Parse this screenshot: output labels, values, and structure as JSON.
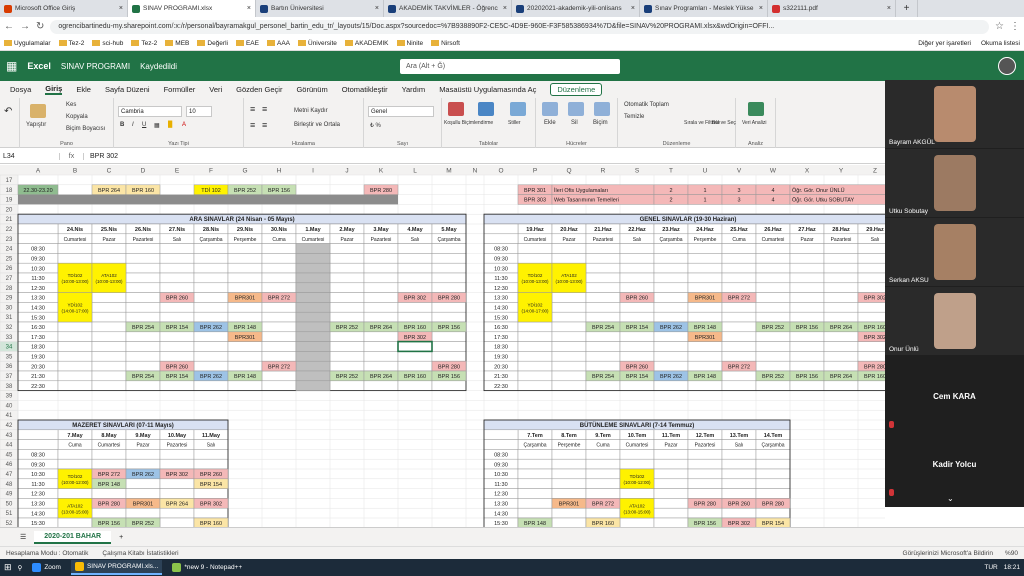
{
  "browser": {
    "tabs": [
      {
        "label": "Microsoft Office Giriş",
        "color": "#d83b01"
      },
      {
        "label": "SINAV PROGRAMI.xlsx",
        "color": "#217346",
        "active": true
      },
      {
        "label": "Bartın Üniversitesi",
        "color": "#1a3f7a"
      },
      {
        "label": "AKADEMİK TAKVİMLER - Öğrenc",
        "color": "#1a3f7a"
      },
      {
        "label": "20202021-akademik-yili-onlisans",
        "color": "#1a3f7a"
      },
      {
        "label": "Sınav Programları - Meslek Yükse",
        "color": "#1a3f7a"
      },
      {
        "label": "s322111.pdf",
        "color": "#d32f2f"
      }
    ],
    "url": "ogrencibartinedu-my.sharepoint.com/:x:/r/personal/bayramakgul_personel_bartin_edu_tr/_layouts/15/Doc.aspx?sourcedoc=%7B938890F2-CE5C-4D9E-960E-F3F585386934%7D&file=SINAV%20PROGRAMI.xlsx&wdOrigin=OFFI...",
    "bookmarks": [
      "Uygulamalar",
      "Tez-2",
      "sci-hub",
      "Tez-2",
      "MEB",
      "Değerli",
      "EAE",
      "AAA",
      "Üniversite",
      "AKADEMIK",
      "Ninite",
      "Nirsoft"
    ],
    "bookmarks_right": [
      "Diğer yer işaretleri",
      "Okuma listesi"
    ]
  },
  "excel": {
    "app": "Excel",
    "doc_title": "SINAV PROGRAMI",
    "saved": "Kaydedildi",
    "search_placeholder": "Ara (Alt + Ğ)",
    "menu": [
      "Dosya",
      "Giriş",
      "Ekle",
      "Sayfa Düzeni",
      "Formüller",
      "Veri",
      "Gözden Geçir",
      "Görünüm",
      "Otomatikleştir",
      "Yardım",
      "Masaüstü Uygulamasında Aç"
    ],
    "menu_selected": "Giriş",
    "edit_mode": "Düzenleme",
    "ribbon": {
      "undo": "Geri Al",
      "paste": "Yapıştır",
      "cut": "Kes",
      "copy": "Kopyala",
      "format_painter": "Biçim Boyacısı",
      "clipboard": "Pano",
      "font": "Cambria",
      "font_size": "10",
      "font_group": "Yazı Tipi",
      "wrap": "Metni Kaydır",
      "merge": "Birleştir ve Ortala",
      "align_group": "Hizalama",
      "number_format": "Genel",
      "number_group": "Sayı",
      "cond_format": "Koşullu Biçimlendirme",
      "table_format": "Tablo Olarak Biçimlendir",
      "styles": "Stiller",
      "tables_group": "Tablolar",
      "insert": "Ekle",
      "delete": "Sil",
      "format": "Biçim",
      "cells_group": "Hücreler",
      "autosum": "Otomatik Toplam",
      "clear": "Temizle",
      "sort": "Sırala ve Filtrele",
      "find": "Bul ve Seç",
      "edit_group": "Düzenleme",
      "analyze": "Veri Analizi",
      "analysis_group": "Analiz"
    },
    "namebox": "L34",
    "formula": "BPR 302",
    "columns": [
      "A",
      "B",
      "C",
      "D",
      "E",
      "F",
      "G",
      "H",
      "I",
      "J",
      "K",
      "L",
      "M",
      "N",
      "O",
      "P",
      "Q",
      "R",
      "S",
      "T",
      "U",
      "V",
      "W",
      "X",
      "Y",
      "Z"
    ],
    "sheet_tab": "2020-201 BAHAR",
    "status_left": [
      "Hesaplama Modu : Otomatik",
      "Çalışma Kitabı İstatistikleri"
    ],
    "status_right": [
      "Görüşlerinizi Microsoft'a Bildirin",
      "%90"
    ]
  },
  "sheet": {
    "top_rows": {
      "r18_time": "22.30-23.20",
      "left": [
        "BPR 264",
        "BPR 160",
        "TDİ 102",
        "BPR 252",
        "BPR 156",
        "BPR 280"
      ],
      "right_rows": [
        {
          "code": "BPR 301",
          "name": "İleri Ofis Uygulamaları",
          "a": "2",
          "b": "1",
          "c": "3",
          "d": "4",
          "teacher": "Öğr. Gör. Onur ÜNLÜ"
        },
        {
          "code": "BPR 303",
          "name": "Web Tasarımının Temelleri",
          "a": "2",
          "b": "1",
          "c": "3",
          "d": "4",
          "teacher": "Öğr. Gör. Utku SOBUTAY"
        }
      ]
    },
    "ara": {
      "title": "ARA SINAVLAR (24 Nisan - 05 Mayıs)",
      "dates": [
        "24.Nis",
        "25.Nis",
        "26.Nis",
        "27.Nis",
        "28.Nis",
        "29.Nis",
        "30.Nis",
        "1.May",
        "2.May",
        "3.May",
        "4.May",
        "5.May"
      ],
      "days": [
        "Cumartesi",
        "Pazar",
        "Pazartesi",
        "Salı",
        "Çarşamba",
        "Perşembe",
        "Cuma",
        "Cumartesi",
        "Pazar",
        "Pazartesi",
        "Salı",
        "Çarşamba"
      ]
    },
    "genel": {
      "title": "GENEL SINAVLAR (19-30 Haziran)",
      "dates": [
        "19.Haz",
        "20.Haz",
        "21.Haz",
        "22.Haz",
        "23.Haz",
        "24.Haz",
        "25.Haz",
        "26.Haz",
        "27.Haz",
        "28.Haz",
        "29.Haz"
      ],
      "days": [
        "Cumartesi",
        "Pazar",
        "Pazartesi",
        "Salı",
        "Çarşamba",
        "Perşembe",
        "Cuma",
        "Cumartesi",
        "Pazar",
        "Pazartesi",
        "Salı"
      ]
    },
    "mazeret": {
      "title": "MAZERET SINAVLARI (07-11 Mayıs)",
      "dates": [
        "7.May",
        "8.May",
        "9.May",
        "10.May",
        "11.May"
      ],
      "days": [
        "Cuma",
        "Cumartesi",
        "Pazar",
        "Pazartesi",
        "Salı"
      ]
    },
    "butunleme": {
      "title": "BÜTÜNLEME SINAVLARI (7-14 Temmuz)",
      "dates": [
        "7.Tem",
        "8.Tem",
        "9.Tem",
        "10.Tem",
        "11.Tem",
        "12.Tem",
        "13.Tem",
        "14.Tem"
      ],
      "days": [
        "Çarşamba",
        "Perşembe",
        "Cuma",
        "Cumartesi",
        "Pazar",
        "Pazartesi",
        "Salı",
        "Çarşamba"
      ]
    },
    "times": [
      "08:30",
      "09:30",
      "10:30",
      "11:30",
      "12:30",
      "13:30",
      "14:30",
      "15:30",
      "16:30",
      "17:30",
      "18:30",
      "19:30",
      "20:30",
      "21:30",
      "22:30"
    ],
    "bottom_times": [
      "08:30",
      "09:30",
      "10:30",
      "11:30",
      "12:30",
      "13:30",
      "14:30",
      "15:30",
      "16:30"
    ],
    "cells": {
      "tdi_a": "TDİ102\n(10:00-13:00)",
      "ata_a": "ATA102\n(10:00-13:00)",
      "tdi_b": "YDİ102\n(14:00-17:00)",
      "bpr260": "BPR 260",
      "bpr301": "BPR301",
      "bpr272": "BPR 272",
      "bpr302": "BPR 302",
      "bpr280": "BPR 280",
      "bpr254": "BPR 254",
      "bpr154": "BPR 154",
      "bpr262": "BPR 262",
      "bpr148": "BPR 148",
      "bpr252": "BPR 252",
      "bpr264": "BPR 264",
      "bpr160": "BPR 160",
      "bpr156": "BPR 156",
      "tdi102": "TDİ102\n(10:00-12:00)",
      "ata102": "ATA102\n(13:00-15:00)",
      "ata_short": "ATA102"
    }
  },
  "meeting": {
    "participants": [
      "Bayram AKGÜL",
      "Utku Sobutay",
      "Serkan AKSU",
      "Onur Ünlü"
    ],
    "camera_off": [
      "Cem KARA",
      "Kadir Yolcu"
    ]
  },
  "taskbar": {
    "items": [
      "Zoom",
      "SINAV PROGRAMI.xls...",
      "*new 9 - Notepad++"
    ],
    "clock": "18:21",
    "lang": "TUR"
  }
}
